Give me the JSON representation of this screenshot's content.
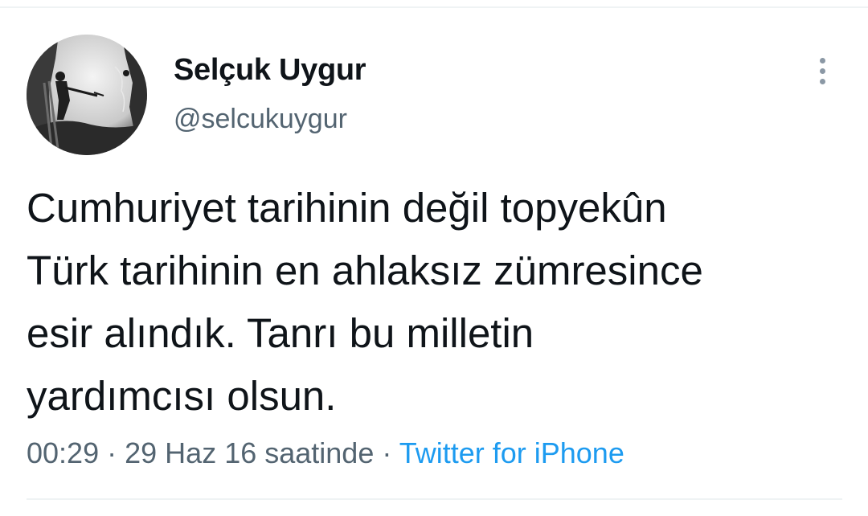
{
  "tweet": {
    "author": {
      "display_name": "Selçuk Uygur",
      "handle": "@selcukuygur"
    },
    "text_lines": [
      "Cumhuriyet tarihinin değil topyekûn",
      "Türk tarihinin en ahlaksız zümresince",
      "esir alındık. Tanrı bu milletin",
      "yardımcısı olsun."
    ],
    "time": "00:29",
    "separator": "·",
    "date": "29 Haz 16 saatinde",
    "source": "Twitter for iPhone"
  },
  "icons": {
    "more": "more-vertical-icon",
    "avatar": "avatar-photo"
  },
  "colors": {
    "text_primary": "#0f1419",
    "text_secondary": "#536471",
    "link": "#1d9bf0",
    "divider": "#eff3f4"
  }
}
